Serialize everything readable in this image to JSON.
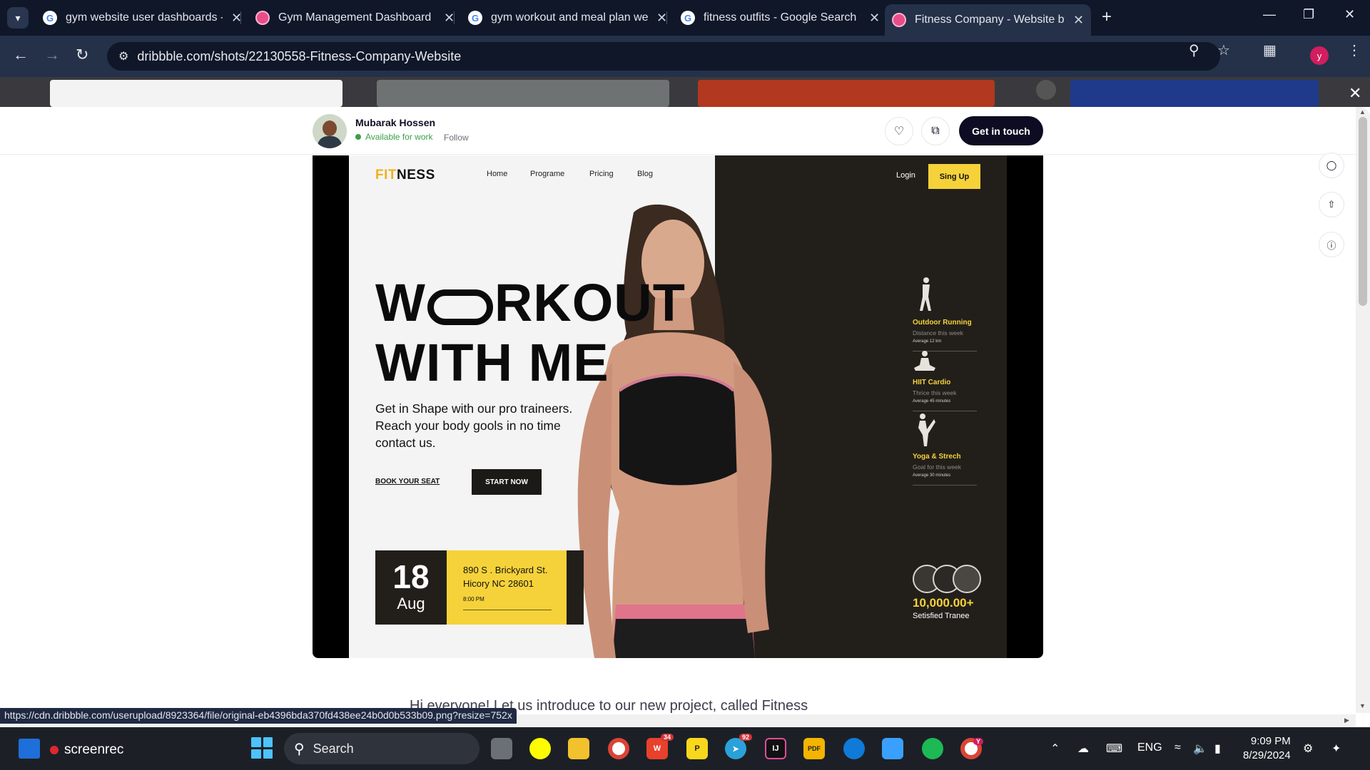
{
  "browser": {
    "tabs": [
      {
        "title": "gym website user dashboards -",
        "favicon": "google-icon",
        "active": false
      },
      {
        "title": "Gym Management Dashboard |",
        "favicon": "dribbble-icon",
        "active": false
      },
      {
        "title": "gym workout and meal plan we",
        "favicon": "google-icon",
        "active": false
      },
      {
        "title": "fitness outfits - Google Search",
        "favicon": "google-icon",
        "active": false
      },
      {
        "title": "Fitness Company - Website by",
        "favicon": "dribbble-icon",
        "active": true
      }
    ],
    "url": "dribbble.com/shots/22130558-Fitness-Company-Website",
    "profile_initial": "y",
    "status_url": "https://cdn.dribbble.com/userupload/8923364/file/original-eb4396bda370fd438ee24b0d0b533b09.png?resize=752x"
  },
  "shot_header": {
    "author_name": "Mubarak Hossen",
    "availability": "Available for work",
    "follow_label": "Follow",
    "cta_label": "Get in touch"
  },
  "website": {
    "logo_fit": "FIT",
    "logo_ness": "NESS",
    "nav": [
      "Home",
      "Programe",
      "Pricing",
      "Blog"
    ],
    "login_label": "Login",
    "signup_label": "Sing Up",
    "hero_line1_start": "W",
    "hero_line1_end": "RKOUT",
    "hero_line2": "WITH ME",
    "hero_subtitle": "Get in Shape with our pro traineers. Reach your body gools in no time contact us.",
    "book_label": "BOOK YOUR SEAT",
    "start_label": "START NOW",
    "event": {
      "day": "18",
      "month": "Aug",
      "address_line1": "890 S . Brickyard St.",
      "address_line2": "Hicory NC 28601",
      "time": "8:00 PM"
    },
    "activities": [
      {
        "title": "Outdoor Running",
        "subtitle": "Distance this week",
        "average": "Average 12 km",
        "icon": "running-figure-icon"
      },
      {
        "title": "HIIT Cardio",
        "subtitle": "Thrice this week",
        "average": "Average 45 minutes",
        "icon": "meditation-figure-icon"
      },
      {
        "title": "Yoga & Strech",
        "subtitle": "Goal for this week",
        "average": "Average 30 minutes",
        "icon": "yoga-figure-icon"
      }
    ],
    "trainee_count": "10,000.00+",
    "trainee_label": "Setisfied Tranee"
  },
  "description_preview": "Hi everyone! Let us introduce to our new project, called Fitness",
  "taskbar": {
    "screenrec_label": "screenrec",
    "search_label": "Search",
    "telegram_badge": "92",
    "chrome_profile_badge": "Y",
    "wps_badge": "34",
    "language": "ENG",
    "time": "9:09 PM",
    "date": "8/29/2024"
  },
  "colors": {
    "accent_yellow": "#f6d23a",
    "dark_panel": "#221f1b",
    "chrome_dark": "#0f1729",
    "dribbble_pink": "#ea4c89"
  }
}
